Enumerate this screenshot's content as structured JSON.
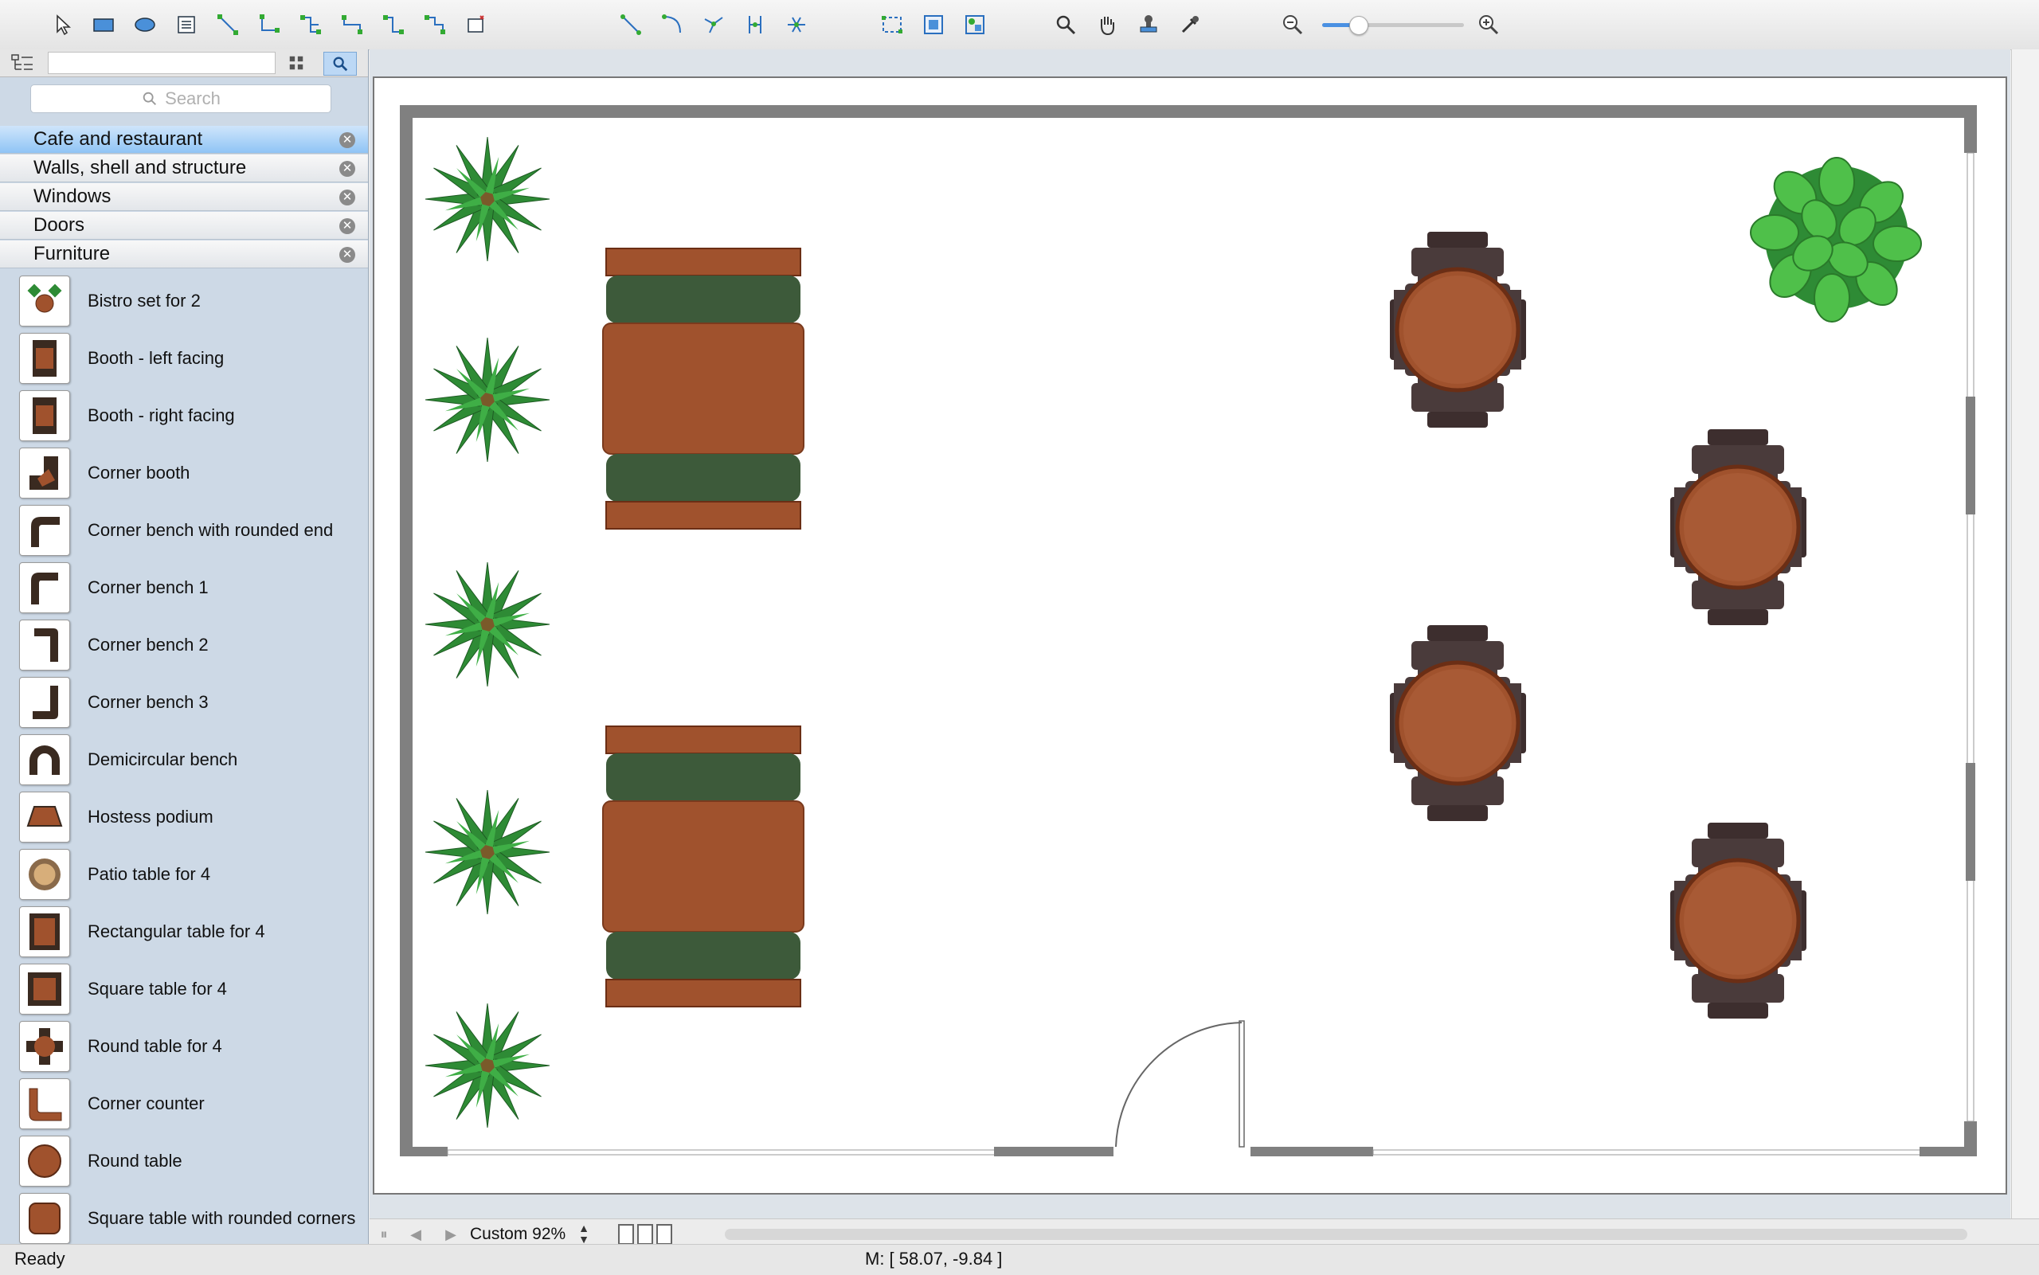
{
  "sidebar": {
    "search_placeholder": "Search",
    "categories": [
      {
        "label": "Cafe and restaurant",
        "active": true
      },
      {
        "label": "Walls, shell and structure",
        "active": false
      },
      {
        "label": "Windows",
        "active": false
      },
      {
        "label": "Doors",
        "active": false
      },
      {
        "label": "Furniture",
        "active": false
      }
    ],
    "shapes": [
      {
        "label": "Bistro set for 2"
      },
      {
        "label": "Booth - left facing"
      },
      {
        "label": "Booth - right facing"
      },
      {
        "label": "Corner booth"
      },
      {
        "label": "Corner bench with rounded end"
      },
      {
        "label": "Corner bench 1"
      },
      {
        "label": "Corner bench 2"
      },
      {
        "label": "Corner bench 3"
      },
      {
        "label": "Demicircular bench"
      },
      {
        "label": "Hostess podium"
      },
      {
        "label": "Patio table for 4"
      },
      {
        "label": "Rectangular table for 4"
      },
      {
        "label": "Square table for 4"
      },
      {
        "label": "Round table for 4"
      },
      {
        "label": "Corner counter"
      },
      {
        "label": "Round table"
      },
      {
        "label": "Square table with rounded corners"
      }
    ]
  },
  "toolbar": {
    "groups": [
      [
        "select-pointer-icon",
        "rectangle-tool-icon",
        "ellipse-tool-icon",
        "text-block-icon",
        "connector-icon",
        "smart-connector-icon",
        "tree-connector-icon",
        "angled-connector-icon",
        "rounded-connector-icon",
        "multi-connector-icon",
        "insert-object-icon"
      ],
      [
        "line-tool-icon",
        "arc-tool-icon",
        "curve-tool-icon",
        "spline-tool-icon",
        "bezier-tool-icon"
      ],
      [
        "chain-icon",
        "snap-grid-icon",
        "group-icon"
      ],
      [
        "zoom-glass-icon",
        "pan-hand-icon",
        "stamp-icon",
        "eyedropper-icon"
      ]
    ],
    "zoom_level": 0.25
  },
  "bottom": {
    "zoom_label": "Custom 92%"
  },
  "status": {
    "text": "Ready",
    "coords": "M: [ 58.07, -9.84 ]"
  },
  "colors": {
    "plant": "#2e8b35",
    "table": "#a0522d",
    "chair": "#4a3b3b",
    "booth_cushion": "#3d5a3a",
    "wall": "#808080"
  }
}
